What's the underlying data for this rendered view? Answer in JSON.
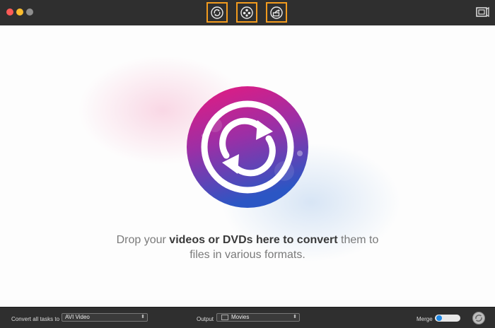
{
  "toolbar": {
    "tabs": [
      {
        "number": "1",
        "icon": "convert-icon"
      },
      {
        "number": "2",
        "icon": "film-reel-icon"
      },
      {
        "number": "3",
        "icon": "share-icon"
      }
    ],
    "right_icon": "media-browser-icon",
    "annotation_color": "#f29b1e"
  },
  "main": {
    "drop_text_pre": "Drop your ",
    "drop_text_bold": "videos or DVDs here to convert",
    "drop_text_post": " them to files in various formats.",
    "hero_icon": "convert-arrows-icon"
  },
  "bottom": {
    "convert_all_label": "Convert all tasks to",
    "format_value": "AVI Video",
    "output_label": "Output",
    "output_value": "Movies",
    "merge_label": "Merge",
    "accent": "#1e88e5"
  }
}
